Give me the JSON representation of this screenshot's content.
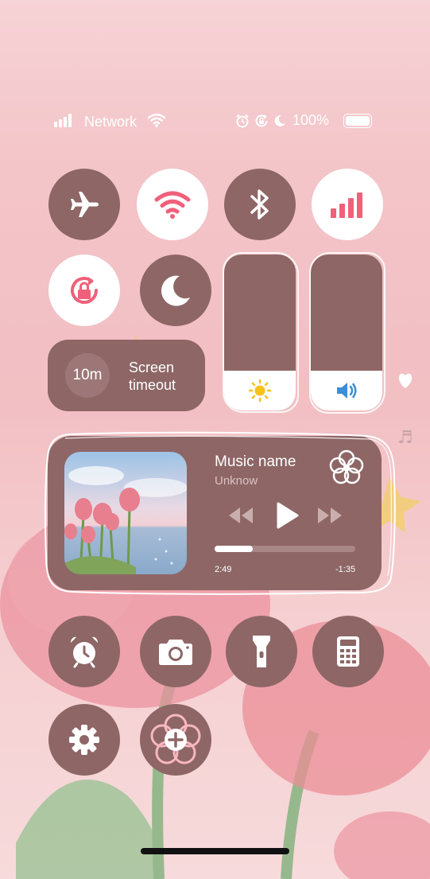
{
  "status_bar": {
    "carrier": "Network",
    "battery": "100%",
    "signal_bars": 4,
    "icons": [
      "signal-icon",
      "wifi-icon",
      "alarm-icon",
      "screen-lock-icon",
      "moon-icon",
      "battery-icon"
    ]
  },
  "toggles": {
    "airplane": {
      "icon": "airplane-icon",
      "state": "off"
    },
    "wifi": {
      "icon": "wifi-icon",
      "state": "on"
    },
    "bluetooth": {
      "icon": "bluetooth-icon",
      "state": "off"
    },
    "mobile_data": {
      "icon": "cellular-icon",
      "state": "on"
    },
    "rotation_lock": {
      "icon": "rotation-lock-icon",
      "state": "on"
    },
    "do_not_disturb": {
      "icon": "moon-icon",
      "state": "off"
    }
  },
  "sliders": {
    "brightness": {
      "icon": "sun-icon",
      "level": 0.25
    },
    "volume": {
      "icon": "speaker-icon",
      "level": 0.25
    }
  },
  "screen_timeout": {
    "value": "10m",
    "label_line1": "Screen",
    "label_line2": "timeout"
  },
  "music": {
    "title": "Music name",
    "artist": "Unknow",
    "elapsed": "2:49",
    "remaining": "-1:35",
    "progress": 0.27
  },
  "shortcuts": [
    "alarm-clock-icon",
    "camera-icon",
    "flashlight-icon",
    "calculator-icon",
    "settings-icon",
    "add-icon"
  ],
  "colors": {
    "tile_dark": "#8e6666",
    "accent": "#f0607a",
    "white": "#ffffff"
  }
}
